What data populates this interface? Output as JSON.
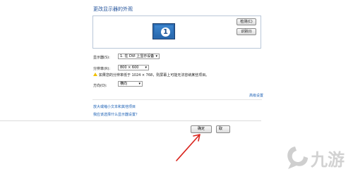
{
  "window": {
    "title": "更改显示器的外观"
  },
  "preview": {
    "monitor_number": "1",
    "detect_label": "检测(C)",
    "identify_label": "识别(I)"
  },
  "display": {
    "label": "显示器(S):",
    "value": "1. 在 DVI 上显示设备"
  },
  "resolution": {
    "label": "分辨率(R):",
    "value": "800 × 600",
    "warning": "如果您的分辨率低于 1024 × 768，则屏幕上可能无法容纳某些项目。"
  },
  "orientation": {
    "label": "方向(O):",
    "value": "横向"
  },
  "links": {
    "advanced": "高级设置",
    "text_size": "放大或缩小文本和其他项目",
    "which_settings": "我应该选择什么显示器设置？"
  },
  "footer": {
    "ok_label": "确定",
    "next_label": "取"
  },
  "watermark": {
    "text": "九游"
  },
  "colors": {
    "title": "#1e4f99",
    "link": "#1a5fb4",
    "monitor": "#2b6ab0",
    "arrow": "#d9231c"
  }
}
